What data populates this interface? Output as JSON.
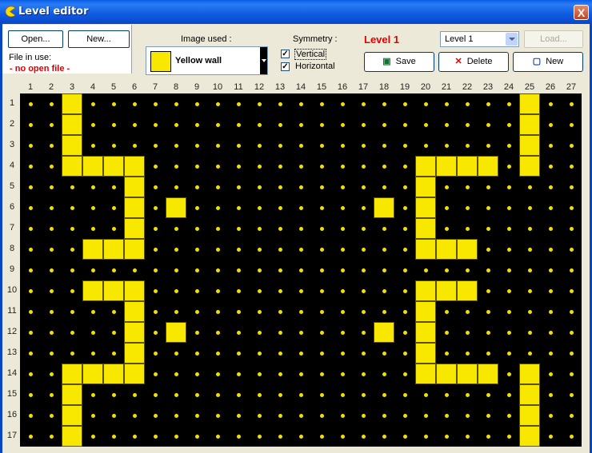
{
  "window": {
    "title": "Level editor",
    "close_glyph": "X"
  },
  "file": {
    "open_label": "Open...",
    "new_label": "New...",
    "file_in_use_label": "File in use:",
    "file_status": "- no open file -"
  },
  "image": {
    "label": "Image used :",
    "selected": "Yellow wall",
    "swatch_color": "#f8e800"
  },
  "symmetry": {
    "label": "Symmetry :",
    "vertical_label": "Vertical",
    "vertical_checked": true,
    "horizontal_label": "Horizontal",
    "horizontal_checked": true
  },
  "level": {
    "title": "Level 1",
    "select_value": "Level 1",
    "load_label": "Load...",
    "save_label": "Save",
    "delete_label": "Delete",
    "new_label": "New"
  },
  "grid": {
    "columns": [
      "1",
      "2",
      "3",
      "4",
      "5",
      "6",
      "7",
      "8",
      "9",
      "10",
      "11",
      "12",
      "13",
      "14",
      "15",
      "16",
      "17",
      "18",
      "19",
      "20",
      "21",
      "22",
      "23",
      "24",
      "25",
      "26",
      "27"
    ],
    "rows": [
      "1",
      "2",
      "3",
      "4",
      "5",
      "6",
      "7",
      "8",
      "9",
      "10",
      "11",
      "12",
      "13",
      "14",
      "15",
      "16",
      "17"
    ],
    "walls": [
      "..#.....................#..",
      "..#.....................#..",
      "..#.....................#..",
      "..####.............####.#..",
      ".....#.............#.......",
      ".....#.#.........#.#.......",
      ".....#.............#.......",
      "...###.............###.....",
      "...........................",
      "...###.............###.....",
      ".....#.............#.......",
      ".....#.#.........#.#.......",
      ".....#.............#.......",
      "..####.............####.#..",
      "..#.....................#..",
      "..#.....................#..",
      "..#.....................#.."
    ]
  }
}
